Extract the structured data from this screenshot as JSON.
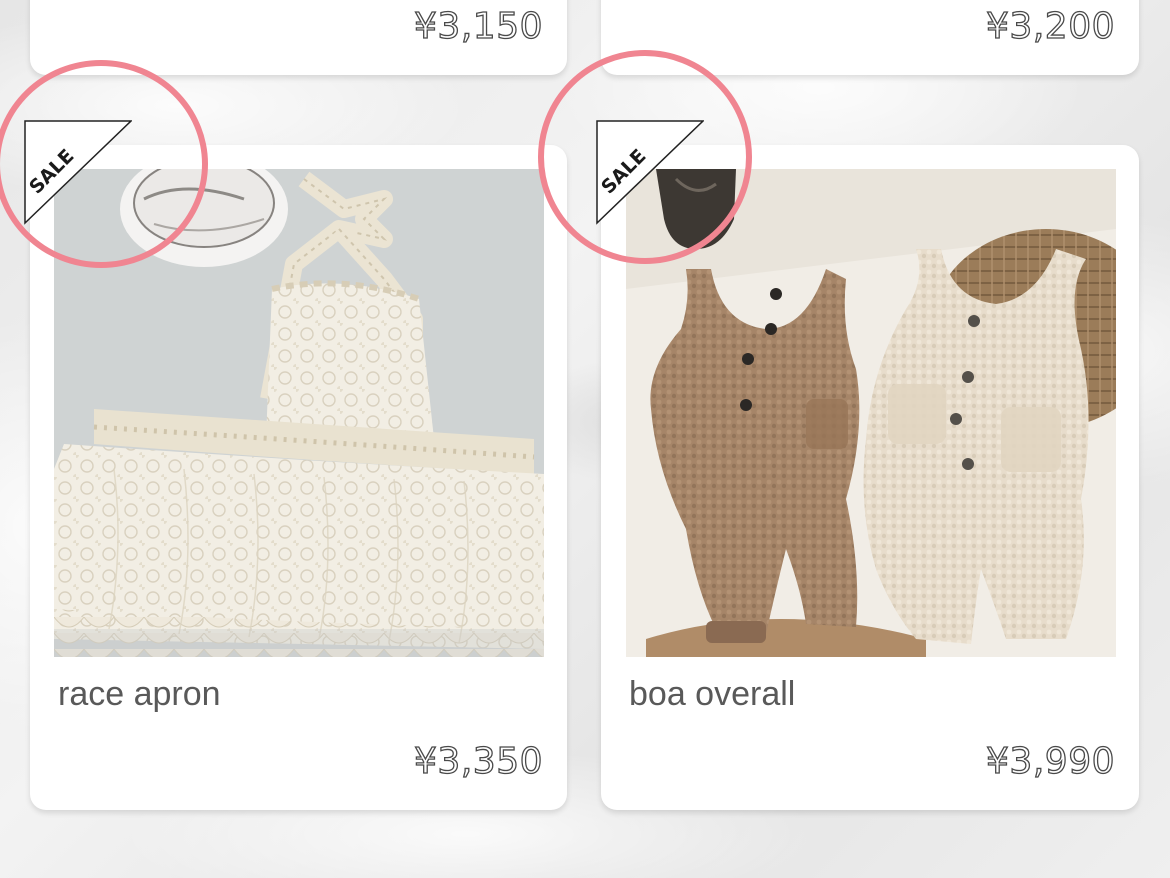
{
  "top_row": [
    {
      "price": "¥3,150"
    },
    {
      "price": "¥3,200"
    }
  ],
  "products": [
    {
      "title": "race apron",
      "price": "¥3,350",
      "badge": "SALE"
    },
    {
      "title": "boa overall",
      "price": "¥3,990",
      "badge": "SALE"
    }
  ],
  "colors": {
    "highlight_circle": "#f08591",
    "price_text": "#4a4a4a",
    "title_text": "#595959"
  }
}
